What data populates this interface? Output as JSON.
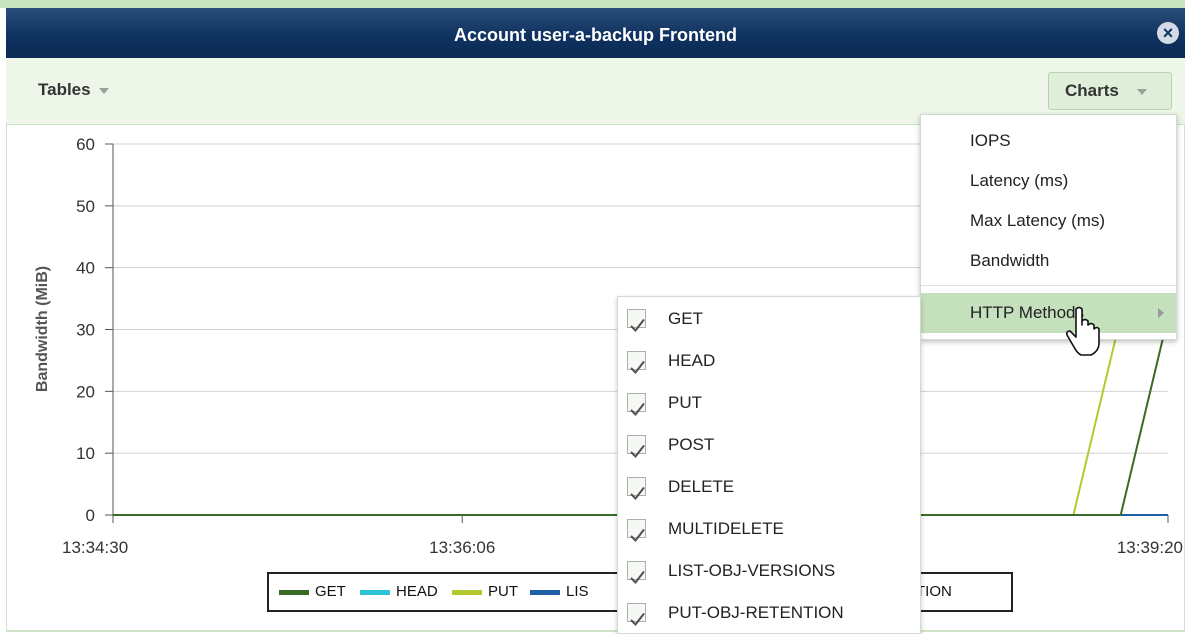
{
  "window": {
    "title": "Account user-a-backup Frontend",
    "close_icon": "close-icon"
  },
  "toolbar": {
    "tables_label": "Tables",
    "charts_label": "Charts"
  },
  "chart_data": {
    "type": "line",
    "ylabel": "Bandwidth (MiB)",
    "xlabel": "",
    "ylim": [
      0,
      60
    ],
    "yticks": [
      "0",
      "10",
      "20",
      "30",
      "40",
      "50",
      "60"
    ],
    "xticks": [
      "13:34:30",
      "13:36:06",
      "13:39:20"
    ],
    "x": [
      "13:34:30",
      "13:36:06",
      "13:38:54",
      "13:39:07",
      "13:39:20"
    ],
    "series": [
      {
        "name": "GET",
        "color": "#3a6b26",
        "values": [
          0,
          0,
          0,
          0,
          32
        ]
      },
      {
        "name": "HEAD",
        "color": "#2ec4d6",
        "values": [
          0,
          0,
          0,
          0,
          0
        ]
      },
      {
        "name": "PUT",
        "color": "#b5c92c",
        "values": [
          0,
          0,
          0,
          32,
          32
        ]
      },
      {
        "name": "LIS",
        "color": "#1f5fa8",
        "values": [
          0,
          0,
          0,
          0,
          0
        ]
      }
    ],
    "legend_items": [
      "GET",
      "HEAD",
      "PUT",
      "LIS",
      "ETENTION"
    ],
    "grid": true,
    "legend_placement": "bottom-center"
  },
  "charts_menu": {
    "items": [
      {
        "label": "IOPS"
      },
      {
        "label": "Latency (ms)"
      },
      {
        "label": "Max Latency (ms)"
      },
      {
        "label": "Bandwidth"
      },
      {
        "label": "HTTP Methods",
        "has_submenu": true,
        "active": true
      }
    ]
  },
  "http_methods_menu": {
    "items": [
      {
        "label": "GET",
        "checked": true
      },
      {
        "label": "HEAD",
        "checked": true
      },
      {
        "label": "PUT",
        "checked": true
      },
      {
        "label": "POST",
        "checked": true
      },
      {
        "label": "DELETE",
        "checked": true
      },
      {
        "label": "MULTIDELETE",
        "checked": true
      },
      {
        "label": "LIST-OBJ-VERSIONS",
        "checked": true
      },
      {
        "label": "PUT-OBJ-RETENTION",
        "checked": true
      }
    ]
  }
}
